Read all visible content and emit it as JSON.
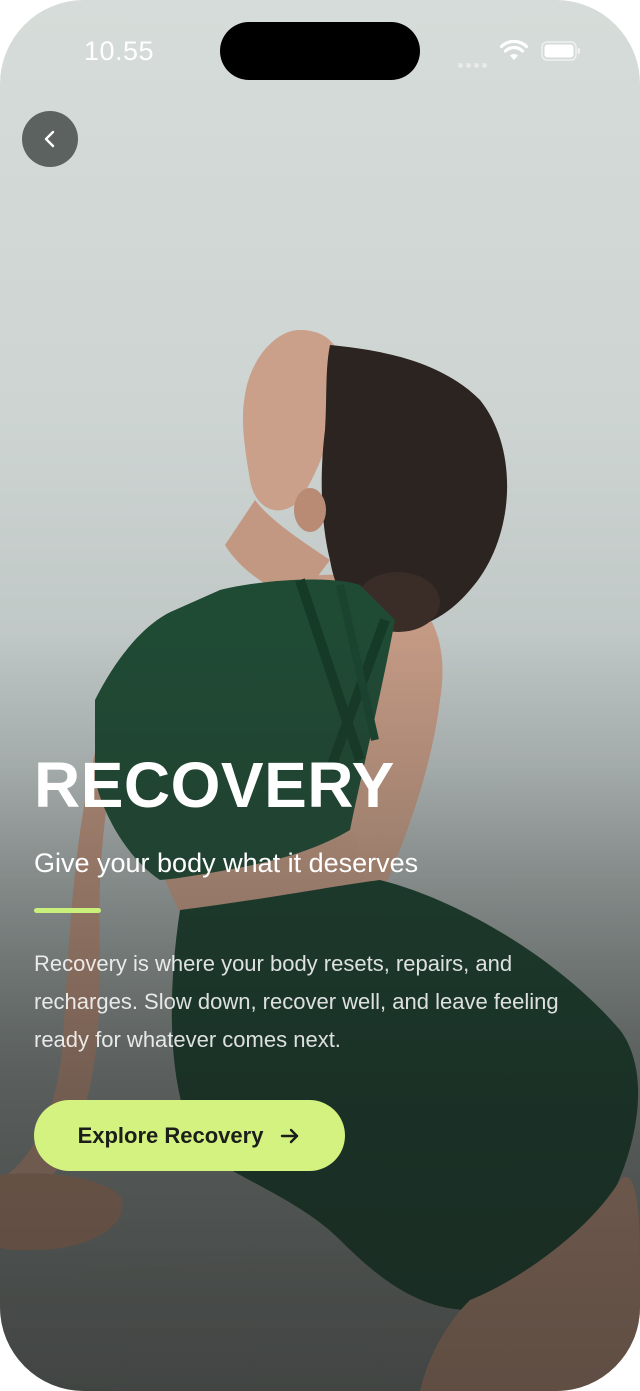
{
  "status_bar": {
    "time": "10.55",
    "icons": [
      "signal-icon",
      "wifi-icon",
      "battery-icon"
    ]
  },
  "navigation": {
    "back_icon": "chevron-left-icon"
  },
  "hero": {
    "title": "RECOVERY",
    "subtitle": "Give your body what it deserves",
    "description": "Recovery is where your body resets, repairs, and recharges. Slow down, recover well, and leave feeling ready for whatever comes next."
  },
  "cta": {
    "label": "Explore Recovery",
    "icon": "arrow-right-icon"
  },
  "colors": {
    "accent": "#c9f07a",
    "button_bg": "#d4f27f",
    "text": "#ffffff",
    "outfit": "#1f4a34"
  }
}
